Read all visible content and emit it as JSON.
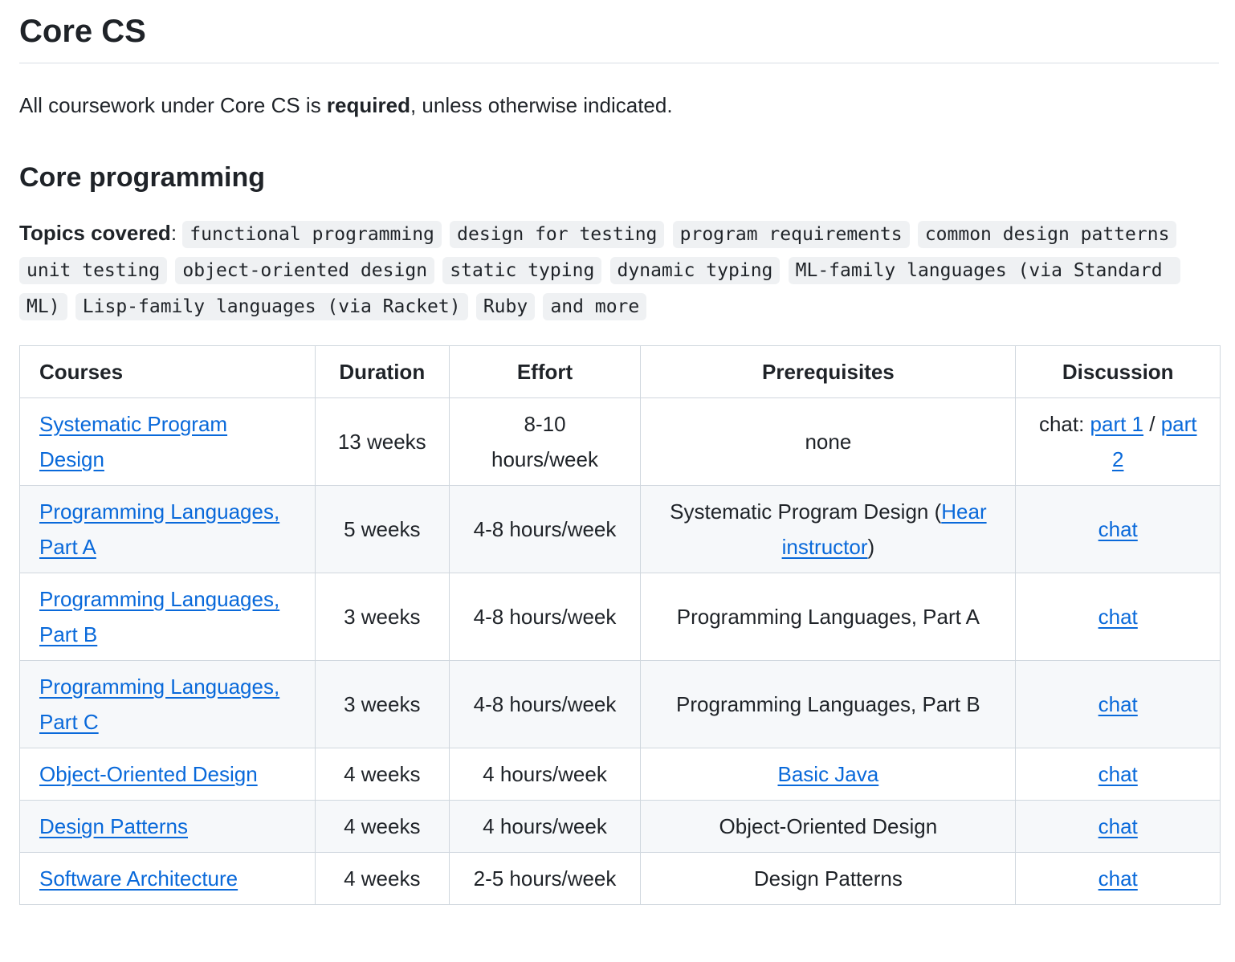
{
  "heading": "Core CS",
  "intro": {
    "before": "All coursework under Core CS is ",
    "bold": "required",
    "after": ", unless otherwise indicated."
  },
  "section_title": "Core programming",
  "topics": {
    "label": "Topics covered",
    "colon": ": ",
    "items": [
      "functional programming",
      "design for testing",
      "program requirements",
      "common design patterns",
      "unit testing",
      "object-oriented design",
      "static typing",
      "dynamic typing",
      "ML-family languages (via Standard ML)",
      "Lisp-family languages (via Racket)",
      "Ruby",
      "and more"
    ]
  },
  "table": {
    "headers": {
      "courses": "Courses",
      "duration": "Duration",
      "effort": "Effort",
      "prerequisites": "Prerequisites",
      "discussion": "Discussion"
    },
    "rows": [
      {
        "course": "Systematic Program Design",
        "duration": "13 weeks",
        "effort": "8-10 hours/week",
        "prereq_text": "none",
        "disc_prefix": "chat: ",
        "disc_link1": "part 1",
        "disc_sep": " / ",
        "disc_link2": "part 2"
      },
      {
        "course": "Programming Languages, Part A",
        "duration": "5 weeks",
        "effort": "4-8 hours/week",
        "prereq_text": "Systematic Program Design (",
        "prereq_link": "Hear instructor",
        "prereq_after": ")",
        "disc_link1": "chat"
      },
      {
        "course": "Programming Languages, Part B",
        "duration": "3 weeks",
        "effort": "4-8 hours/week",
        "prereq_text": "Programming Languages, Part A",
        "disc_link1": "chat"
      },
      {
        "course": "Programming Languages, Part C",
        "duration": "3 weeks",
        "effort": "4-8 hours/week",
        "prereq_text": "Programming Languages, Part B",
        "disc_link1": "chat"
      },
      {
        "course": "Object-Oriented Design",
        "duration": "4 weeks",
        "effort": "4 hours/week",
        "prereq_link": "Basic Java",
        "disc_link1": "chat"
      },
      {
        "course": "Design Patterns",
        "duration": "4 weeks",
        "effort": "4 hours/week",
        "prereq_text": "Object-Oriented Design",
        "disc_link1": "chat"
      },
      {
        "course": "Software Architecture",
        "duration": "4 weeks",
        "effort": "2-5 hours/week",
        "prereq_text": "Design Patterns",
        "disc_link1": "chat"
      }
    ]
  }
}
